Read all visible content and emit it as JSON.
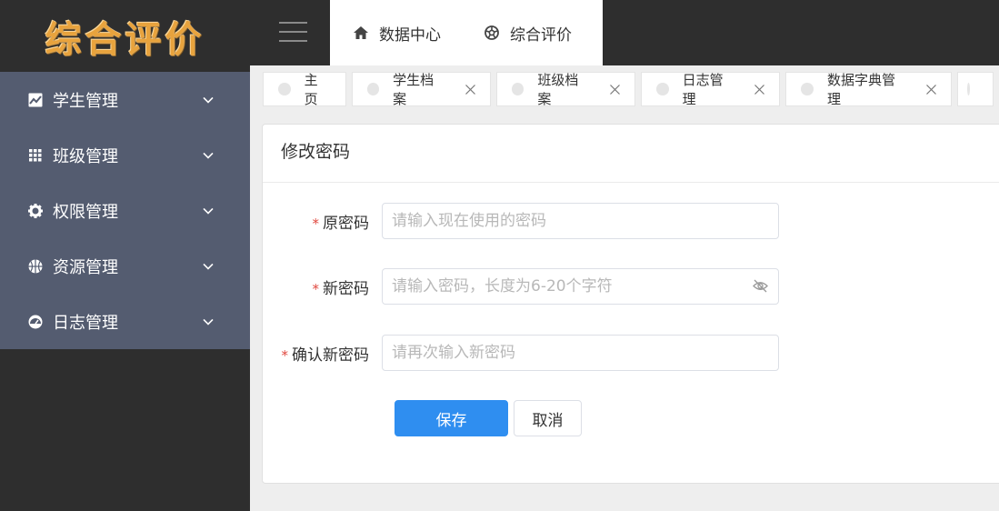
{
  "app": {
    "logo_text": "综合评价"
  },
  "sidebar": {
    "items": [
      {
        "label": "学生管理",
        "icon": "chart-icon"
      },
      {
        "label": "班级管理",
        "icon": "grid-icon"
      },
      {
        "label": "权限管理",
        "icon": "gear-icon"
      },
      {
        "label": "资源管理",
        "icon": "basketball-icon"
      },
      {
        "label": "日志管理",
        "icon": "gauge-icon"
      }
    ]
  },
  "topnav": {
    "items": [
      {
        "label": "数据中心",
        "icon": "home-icon"
      },
      {
        "label": "综合评价",
        "icon": "aperture-icon"
      }
    ]
  },
  "tabs": [
    {
      "label": "主页",
      "closable": false
    },
    {
      "label": "学生档案",
      "closable": true
    },
    {
      "label": "班级档案",
      "closable": true
    },
    {
      "label": "日志管理",
      "closable": true
    },
    {
      "label": "数据字典管理",
      "closable": true
    }
  ],
  "form": {
    "title": "修改密码",
    "fields": [
      {
        "label": "原密码",
        "required": true,
        "placeholder": "请输入现在使用的密码",
        "value": ""
      },
      {
        "label": "新密码",
        "required": true,
        "placeholder": "请输入密码，长度为6-20个字符",
        "value": ""
      },
      {
        "label": "确认新密码",
        "required": true,
        "placeholder": "请再次输入新密码",
        "value": ""
      }
    ],
    "required_mark": "*",
    "save_label": "保存",
    "cancel_label": "取消"
  },
  "colors": {
    "sidebar_bg": "#2e2e2e",
    "menu_bg": "#545c70",
    "logo": "#e8a33d",
    "primary": "#2f8ef0",
    "required": "#e0483f"
  }
}
